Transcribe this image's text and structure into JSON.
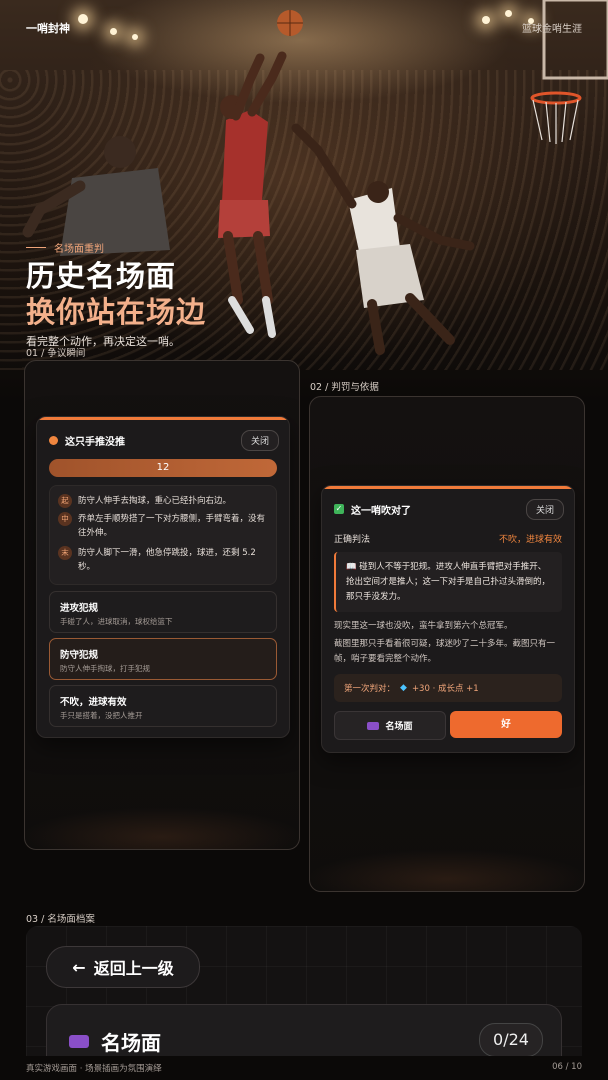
{
  "header": {
    "brand": "一哨封神",
    "brand_right": "篮球金哨生涯"
  },
  "hero": {
    "kicker": "名场面重判",
    "title_line1": "历史名场面",
    "title_line2": "换你站在场边",
    "subtitle": "看完整个动作，再决定这一哨。"
  },
  "sections": {
    "s1": "01 / 争议瞬间",
    "s2": "02 / 判罚与依据",
    "s3": "03 / 名场面档案"
  },
  "question_card": {
    "title": "这只手推没推",
    "close": "关闭",
    "timer": "12",
    "steps": [
      {
        "tag": "起",
        "text": "防守人伸手去掏球，重心已经扑向右边。"
      },
      {
        "tag": "中",
        "text": "乔单左手顺势搭了一下对方腰侧，手臂弯着，没有往外伸。"
      },
      {
        "tag": "末",
        "text": "防守人脚下一滑，他急停跳投，球进，还剩 5.2 秒。"
      }
    ],
    "options": [
      {
        "title": "进攻犯规",
        "desc": "手碰了人，进球取消，球权给篮下"
      },
      {
        "title": "防守犯规",
        "desc": "防守人伸手掏球，打手犯规"
      },
      {
        "title": "不吹，进球有效",
        "desc": "手只是搭着，没把人推开"
      }
    ]
  },
  "result_card": {
    "title": "这一哨吹对了",
    "close": "关闭",
    "label": "正确判法",
    "verdict": "不吹，进球有效",
    "rule_icon": "📖",
    "rule": "碰到人不等于犯规。进攻人伸直手臂把对手推开、抢出空间才是推人；这一下对手是自己扑过头滑倒的，那只手没发力。",
    "para1": "现实里这一球也没吹，蛮牛拿到第六个总冠军。",
    "para2": "截图里那只手看着很可疑，球迷吵了二十多年。截图只有一帧，哨子要看完整个动作。",
    "reward_prefix": "第一次判对：",
    "reward_value": "+30 · 成长点 +1",
    "btn_archive": "名场面",
    "btn_ok": "好"
  },
  "archive": {
    "back": "返回上一级",
    "title": "名场面",
    "counter": "0/24"
  },
  "footer": {
    "left": "真实游戏画面 · 场景插画为氛围演绎",
    "right": "06 / 10"
  },
  "colors": {
    "accent": "#ee6a2e",
    "accent_light": "#f3b08b",
    "success": "#3fb45a",
    "background": "#0b0908"
  },
  "icons": {
    "question": "dot-icon",
    "result": "check-icon",
    "rule": "book-icon",
    "reward": "gem-icon",
    "archive": "film-icon",
    "back": "arrow-left-icon"
  }
}
